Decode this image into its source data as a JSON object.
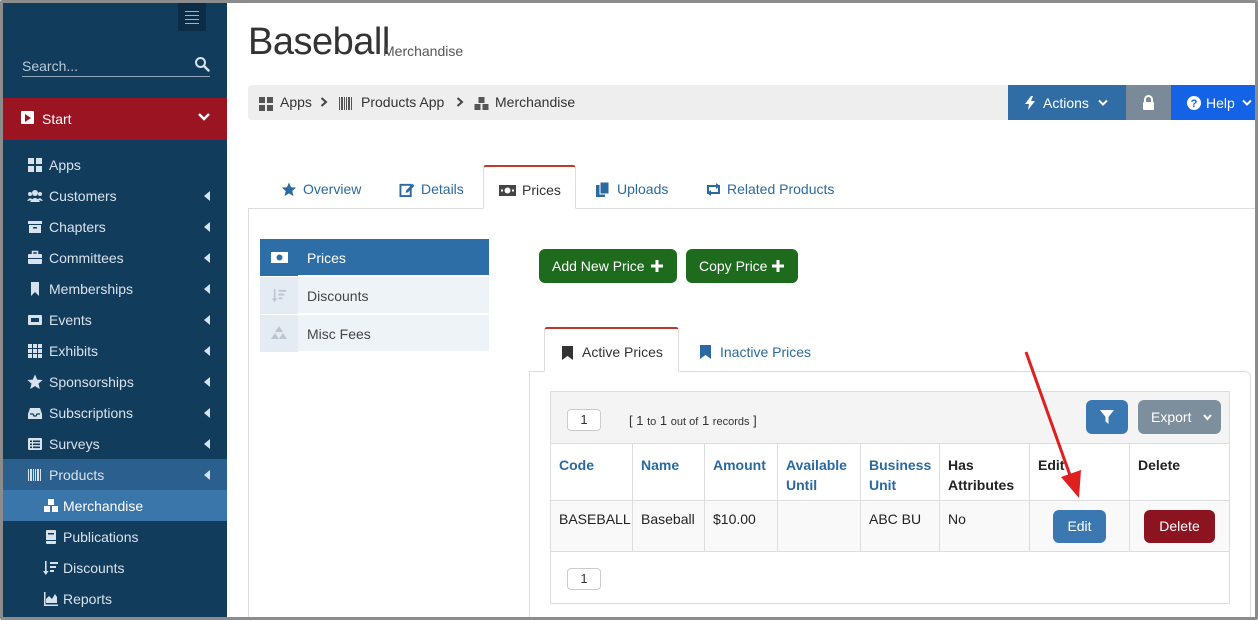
{
  "sidebar": {
    "search_placeholder": "Search...",
    "start_label": "Start",
    "items": [
      {
        "label": "Apps",
        "icon": "grid-icon"
      },
      {
        "label": "Customers",
        "icon": "users-icon"
      },
      {
        "label": "Chapters",
        "icon": "archive-icon"
      },
      {
        "label": "Committees",
        "icon": "briefcase-icon"
      },
      {
        "label": "Memberships",
        "icon": "bookmark-icon"
      },
      {
        "label": "Events",
        "icon": "ticket-icon"
      },
      {
        "label": "Exhibits",
        "icon": "th-icon"
      },
      {
        "label": "Sponsorships",
        "icon": "star-icon"
      },
      {
        "label": "Subscriptions",
        "icon": "inbox-icon"
      },
      {
        "label": "Surveys",
        "icon": "list-icon"
      },
      {
        "label": "Products",
        "icon": "barcode-icon"
      }
    ],
    "subitems": [
      {
        "label": "Merchandise",
        "icon": "cubes-icon"
      },
      {
        "label": "Publications",
        "icon": "book-icon"
      },
      {
        "label": "Discounts",
        "icon": "sort-amount-icon"
      },
      {
        "label": "Reports",
        "icon": "area-chart-icon"
      }
    ]
  },
  "header": {
    "title": "Baseball",
    "subtitle": "Merchandise",
    "breadcrumb": [
      "Apps",
      "Products App",
      "Merchandise"
    ],
    "actions_label": "Actions",
    "help_label": "Help"
  },
  "tabs": [
    "Overview",
    "Details",
    "Prices",
    "Uploads",
    "Related Products"
  ],
  "subnav": [
    "Prices",
    "Discounts",
    "Misc Fees"
  ],
  "buttons": {
    "add_price": "Add New Price",
    "copy_price": "Copy Price"
  },
  "inner_tabs": [
    "Active Prices",
    "Inactive Prices"
  ],
  "grid": {
    "page": "1",
    "records_open": "[",
    "records_from": "1",
    "records_to_word": "to",
    "records_to": "1",
    "records_outof_word": "out of",
    "records_total": "1",
    "records_word": "records",
    "records_close": "]",
    "export_label": "Export",
    "columns": [
      "Code",
      "Name",
      "Amount",
      "Available Until",
      "Business Unit",
      "Has Attributes",
      "Edit",
      "Delete"
    ],
    "row": {
      "code": "BASEBALL",
      "name": "Baseball",
      "amount": "$10.00",
      "available_until": "",
      "business_unit": "ABC BU",
      "has_attributes": "No",
      "edit": "Edit",
      "delete": "Delete"
    },
    "bottom_page": "1"
  },
  "colors": {
    "sidebar": "#123c5c",
    "start": "#9b1421",
    "accent": "#2f6da4",
    "green": "#1e6b1e",
    "danger": "#8b1420",
    "arrow": "#e02020"
  }
}
